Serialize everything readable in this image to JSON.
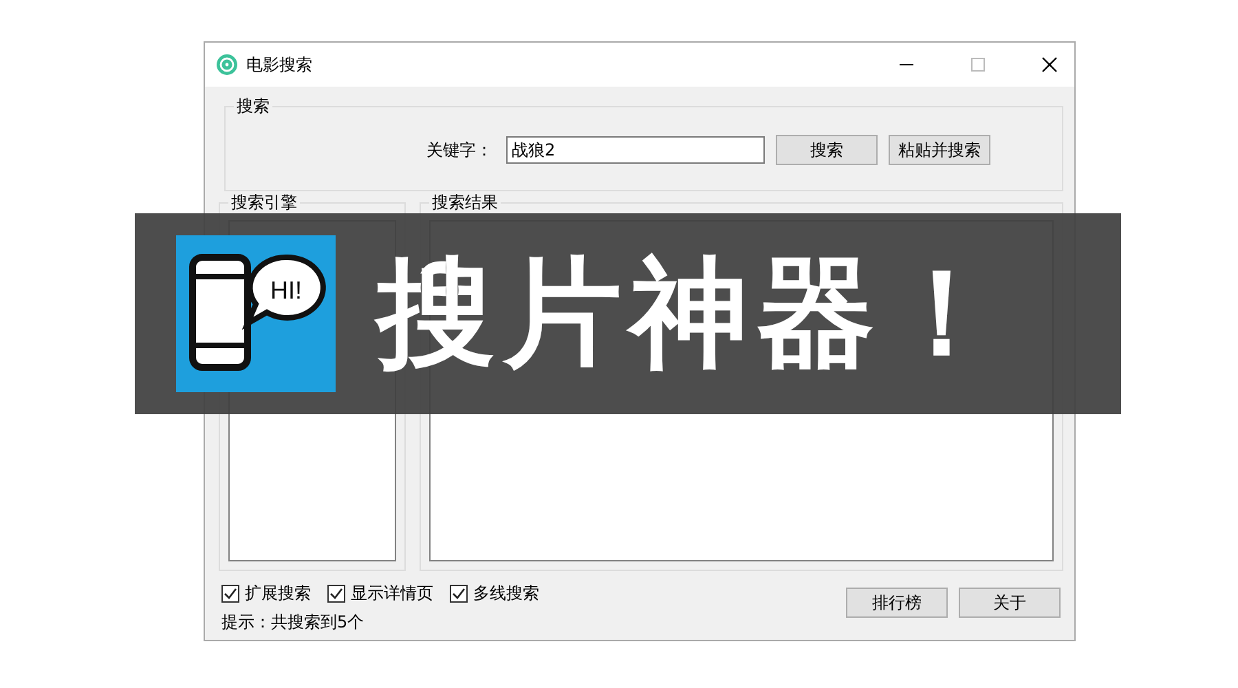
{
  "window": {
    "title": "电影搜索"
  },
  "search_group": {
    "label": "搜索",
    "keyword_label": "关键字：",
    "keyword_value": "战狼2",
    "buttons": [
      "搜索",
      "粘贴并搜索"
    ]
  },
  "engines_panel": {
    "label": "搜索引擎"
  },
  "results_panel": {
    "label": "搜索结果"
  },
  "options": [
    {
      "label": "扩展搜索",
      "checked": true
    },
    {
      "label": "显示详情页",
      "checked": true
    },
    {
      "label": "多线搜索",
      "checked": true
    }
  ],
  "hint": "提示：共搜索到5个",
  "buttons": [
    "排行榜",
    "关于"
  ],
  "banner": {
    "title": "搜片神器！",
    "bubble_text": "HI!"
  }
}
